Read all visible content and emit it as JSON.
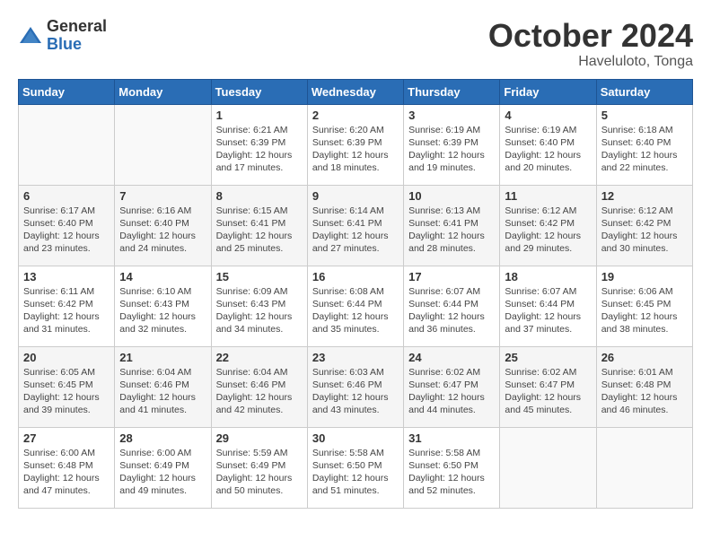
{
  "logo": {
    "general": "General",
    "blue": "Blue"
  },
  "title": {
    "month": "October 2024",
    "location": "Haveluloto, Tonga"
  },
  "weekdays": [
    "Sunday",
    "Monday",
    "Tuesday",
    "Wednesday",
    "Thursday",
    "Friday",
    "Saturday"
  ],
  "weeks": [
    [
      {
        "day": "",
        "info": ""
      },
      {
        "day": "",
        "info": ""
      },
      {
        "day": "1",
        "info": "Sunrise: 6:21 AM\nSunset: 6:39 PM\nDaylight: 12 hours and 17 minutes."
      },
      {
        "day": "2",
        "info": "Sunrise: 6:20 AM\nSunset: 6:39 PM\nDaylight: 12 hours and 18 minutes."
      },
      {
        "day": "3",
        "info": "Sunrise: 6:19 AM\nSunset: 6:39 PM\nDaylight: 12 hours and 19 minutes."
      },
      {
        "day": "4",
        "info": "Sunrise: 6:19 AM\nSunset: 6:40 PM\nDaylight: 12 hours and 20 minutes."
      },
      {
        "day": "5",
        "info": "Sunrise: 6:18 AM\nSunset: 6:40 PM\nDaylight: 12 hours and 22 minutes."
      }
    ],
    [
      {
        "day": "6",
        "info": "Sunrise: 6:17 AM\nSunset: 6:40 PM\nDaylight: 12 hours and 23 minutes."
      },
      {
        "day": "7",
        "info": "Sunrise: 6:16 AM\nSunset: 6:40 PM\nDaylight: 12 hours and 24 minutes."
      },
      {
        "day": "8",
        "info": "Sunrise: 6:15 AM\nSunset: 6:41 PM\nDaylight: 12 hours and 25 minutes."
      },
      {
        "day": "9",
        "info": "Sunrise: 6:14 AM\nSunset: 6:41 PM\nDaylight: 12 hours and 27 minutes."
      },
      {
        "day": "10",
        "info": "Sunrise: 6:13 AM\nSunset: 6:41 PM\nDaylight: 12 hours and 28 minutes."
      },
      {
        "day": "11",
        "info": "Sunrise: 6:12 AM\nSunset: 6:42 PM\nDaylight: 12 hours and 29 minutes."
      },
      {
        "day": "12",
        "info": "Sunrise: 6:12 AM\nSunset: 6:42 PM\nDaylight: 12 hours and 30 minutes."
      }
    ],
    [
      {
        "day": "13",
        "info": "Sunrise: 6:11 AM\nSunset: 6:42 PM\nDaylight: 12 hours and 31 minutes."
      },
      {
        "day": "14",
        "info": "Sunrise: 6:10 AM\nSunset: 6:43 PM\nDaylight: 12 hours and 32 minutes."
      },
      {
        "day": "15",
        "info": "Sunrise: 6:09 AM\nSunset: 6:43 PM\nDaylight: 12 hours and 34 minutes."
      },
      {
        "day": "16",
        "info": "Sunrise: 6:08 AM\nSunset: 6:44 PM\nDaylight: 12 hours and 35 minutes."
      },
      {
        "day": "17",
        "info": "Sunrise: 6:07 AM\nSunset: 6:44 PM\nDaylight: 12 hours and 36 minutes."
      },
      {
        "day": "18",
        "info": "Sunrise: 6:07 AM\nSunset: 6:44 PM\nDaylight: 12 hours and 37 minutes."
      },
      {
        "day": "19",
        "info": "Sunrise: 6:06 AM\nSunset: 6:45 PM\nDaylight: 12 hours and 38 minutes."
      }
    ],
    [
      {
        "day": "20",
        "info": "Sunrise: 6:05 AM\nSunset: 6:45 PM\nDaylight: 12 hours and 39 minutes."
      },
      {
        "day": "21",
        "info": "Sunrise: 6:04 AM\nSunset: 6:46 PM\nDaylight: 12 hours and 41 minutes."
      },
      {
        "day": "22",
        "info": "Sunrise: 6:04 AM\nSunset: 6:46 PM\nDaylight: 12 hours and 42 minutes."
      },
      {
        "day": "23",
        "info": "Sunrise: 6:03 AM\nSunset: 6:46 PM\nDaylight: 12 hours and 43 minutes."
      },
      {
        "day": "24",
        "info": "Sunrise: 6:02 AM\nSunset: 6:47 PM\nDaylight: 12 hours and 44 minutes."
      },
      {
        "day": "25",
        "info": "Sunrise: 6:02 AM\nSunset: 6:47 PM\nDaylight: 12 hours and 45 minutes."
      },
      {
        "day": "26",
        "info": "Sunrise: 6:01 AM\nSunset: 6:48 PM\nDaylight: 12 hours and 46 minutes."
      }
    ],
    [
      {
        "day": "27",
        "info": "Sunrise: 6:00 AM\nSunset: 6:48 PM\nDaylight: 12 hours and 47 minutes."
      },
      {
        "day": "28",
        "info": "Sunrise: 6:00 AM\nSunset: 6:49 PM\nDaylight: 12 hours and 49 minutes."
      },
      {
        "day": "29",
        "info": "Sunrise: 5:59 AM\nSunset: 6:49 PM\nDaylight: 12 hours and 50 minutes."
      },
      {
        "day": "30",
        "info": "Sunrise: 5:58 AM\nSunset: 6:50 PM\nDaylight: 12 hours and 51 minutes."
      },
      {
        "day": "31",
        "info": "Sunrise: 5:58 AM\nSunset: 6:50 PM\nDaylight: 12 hours and 52 minutes."
      },
      {
        "day": "",
        "info": ""
      },
      {
        "day": "",
        "info": ""
      }
    ]
  ]
}
